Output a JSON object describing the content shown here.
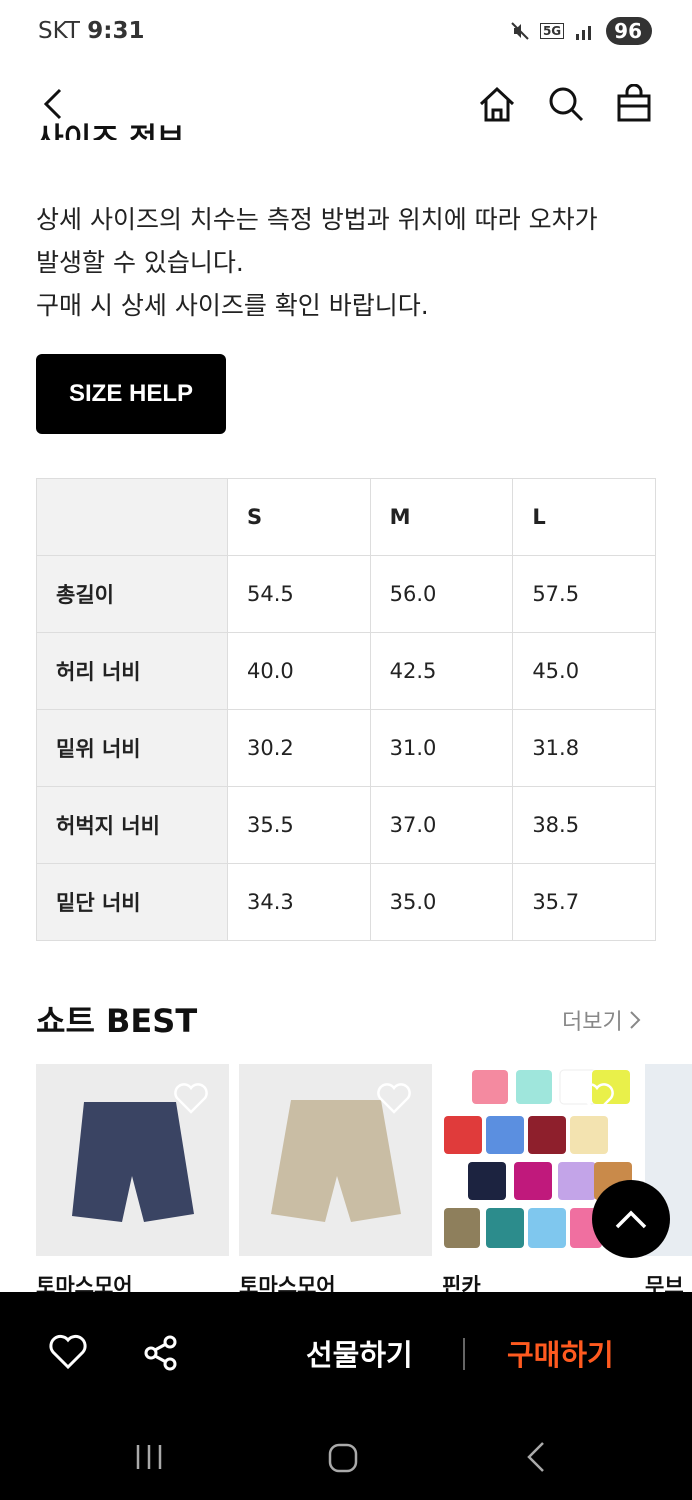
{
  "status_bar": {
    "carrier": "SKT",
    "time": "9:31",
    "network": "5G",
    "battery": "96"
  },
  "notice": {
    "heading_partial": "사이즈 정보",
    "lines": [
      "상세 사이즈의 치수는 측정 방법과 위치에 따라 오차가",
      "발생할 수 있습니다.",
      "구매 시 상세 사이즈를 확인 바랍니다."
    ]
  },
  "size_help_label": "SIZE HELP",
  "size_table": {
    "headers": [
      "",
      "S",
      "M",
      "L"
    ],
    "rows": [
      {
        "label": "총길이",
        "values": [
          "54.5",
          "56.0",
          "57.5"
        ]
      },
      {
        "label": "허리 너비",
        "values": [
          "40.0",
          "42.5",
          "45.0"
        ]
      },
      {
        "label": "밑위 너비",
        "values": [
          "30.2",
          "31.0",
          "31.8"
        ]
      },
      {
        "label": "허벅지 너비",
        "values": [
          "35.5",
          "37.0",
          "38.5"
        ]
      },
      {
        "label": "밑단 너비",
        "values": [
          "34.3",
          "35.0",
          "35.7"
        ]
      }
    ]
  },
  "best": {
    "title": "쇼트 BEST",
    "more_label": "더보기",
    "products": [
      {
        "name": "토마스모어",
        "color": "#3a4463"
      },
      {
        "name": "토마스모어",
        "color": "#c9bda4"
      },
      {
        "name": "핀카",
        "color": "#e04a55"
      },
      {
        "name": "무브웍",
        "color": "#e8edf2"
      }
    ]
  },
  "bottom_bar": {
    "gift_label": "선물하기",
    "buy_label": "구매하기",
    "buy_color": "#ff5a1f"
  },
  "icons": [
    "back-icon",
    "home-icon",
    "search-icon",
    "bag-icon",
    "heart-icon",
    "share-icon",
    "scroll-top-icon"
  ]
}
